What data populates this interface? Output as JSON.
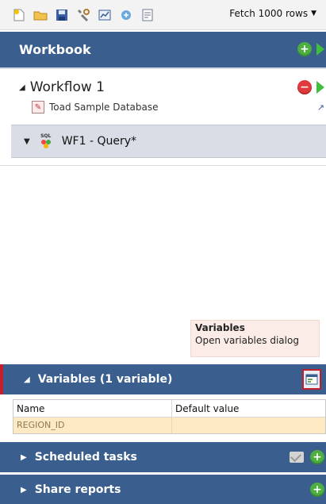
{
  "toolbar": {
    "icons": [
      "new-workflow-icon",
      "open-folder-icon",
      "save-icon",
      "settings-icon",
      "chart-icon",
      "publish-icon",
      "report-icon"
    ],
    "fetch_label": "Fetch 1000 rows"
  },
  "workbook": {
    "title": "Workbook"
  },
  "workflow": {
    "title": "Workflow 1",
    "connection": "Toad Sample Database",
    "query_label": "WF1 - Query*"
  },
  "tooltip": {
    "title": "Variables",
    "text": "Open variables dialog"
  },
  "variables": {
    "header": "Variables (1 variable)",
    "columns": [
      "Name",
      "Default value"
    ],
    "rows": [
      {
        "name": "REGION_ID",
        "default": ""
      }
    ]
  },
  "scheduled": {
    "title": "Scheduled tasks"
  },
  "share": {
    "title": "Share reports"
  },
  "colors": {
    "panel_bg": "#3a5f8f",
    "add_green": "#4caf3f",
    "remove_red": "#e0383b",
    "run_green": "#3fbf3a",
    "highlight_border": "#c21f2b",
    "row_highlight": "#fdeac2"
  }
}
